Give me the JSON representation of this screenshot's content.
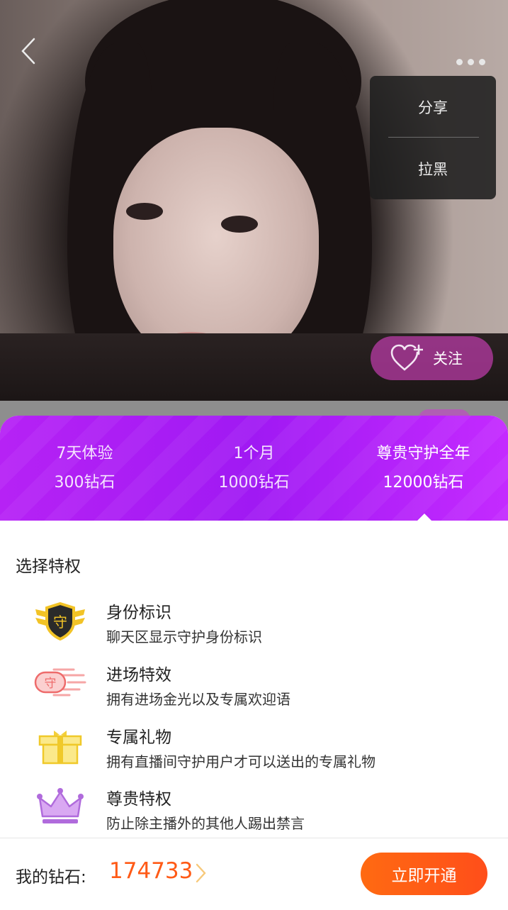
{
  "header": {
    "back_icon": "chevron-left-icon",
    "more_icon": "more-dots-icon"
  },
  "menu": {
    "items": [
      {
        "label": "分享"
      },
      {
        "label": "拉黑"
      }
    ]
  },
  "follow": {
    "label": "关注",
    "icon": "heart-plus-icon"
  },
  "plans": [
    {
      "name": "7天体验",
      "price": "300钻石",
      "selected": false
    },
    {
      "name": "1个月",
      "price": "1000钻石",
      "selected": false
    },
    {
      "name": "尊贵守护全年",
      "price": "12000钻石",
      "selected": true
    }
  ],
  "privileges": {
    "title": "选择特权",
    "items": [
      {
        "name": "身份标识",
        "desc": "聊天区显示守护身份标识",
        "icon": "guard-badge-icon"
      },
      {
        "name": "进场特效",
        "desc": "拥有进场金光以及专属欢迎语",
        "icon": "entry-effect-icon"
      },
      {
        "name": "专属礼物",
        "desc": "拥有直播间守护用户才可以送出的专属礼物",
        "icon": "gift-icon"
      },
      {
        "name": "尊贵特权",
        "desc": "防止除主播外的其他人踢出禁言",
        "icon": "crown-icon"
      }
    ]
  },
  "footer": {
    "label": "我的钻石:",
    "amount": "174733",
    "button": "立即开通"
  },
  "colors": {
    "purple": "#a81cf4",
    "orange": "#ff5a16",
    "gold": "#f2c326"
  }
}
